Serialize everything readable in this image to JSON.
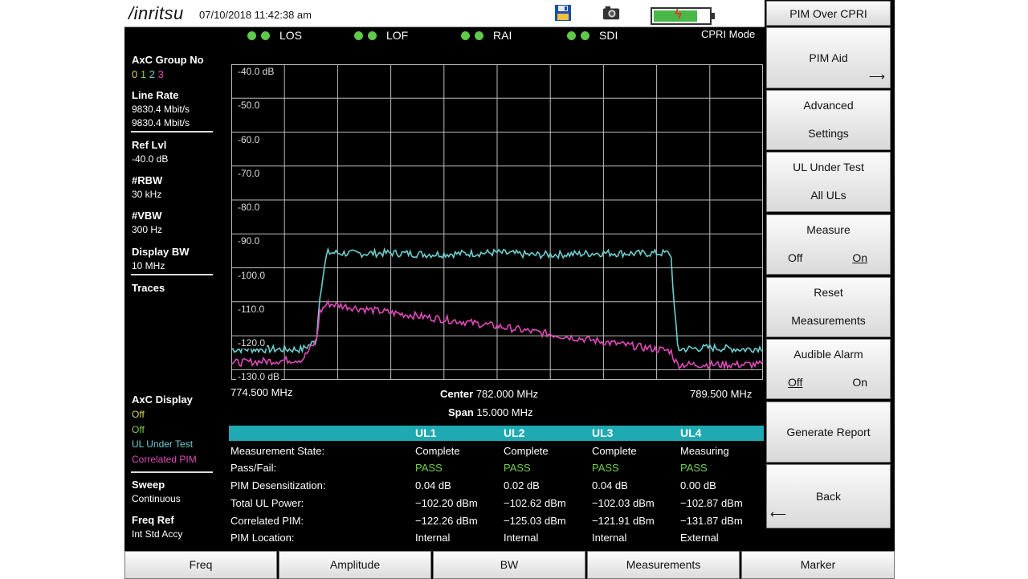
{
  "title_bar": {
    "brand": "/inritsu",
    "datetime": "07/10/2018 11:42:38 am",
    "icons": [
      "floppy-disk-icon",
      "camera-icon",
      "battery-charging-icon"
    ],
    "battery_level": 0.85
  },
  "alarms": [
    {
      "label": "LOS",
      "color": "#5fc94a"
    },
    {
      "label": "LOF",
      "color": "#5fc94a"
    },
    {
      "label": "RAI",
      "color": "#5fc94a"
    },
    {
      "label": "SDI",
      "color": "#5fc94a"
    }
  ],
  "mode": "CPRI Mode",
  "left_panel": {
    "axc_group": {
      "heading": "AxC Group No",
      "digits": [
        "0",
        "1",
        "2",
        "3"
      ],
      "digit_colors": [
        "#d8d860",
        "#7fd04a",
        "#6ccfd0",
        "#e04ab8"
      ]
    },
    "line_rate": {
      "heading": "Line Rate",
      "values": [
        "9830.4 Mbit/s",
        "9830.4 Mbit/s"
      ]
    },
    "ref_lvl": {
      "heading": "Ref Lvl",
      "value": "-40.0 dB"
    },
    "rbw": {
      "heading": "#RBW",
      "value": "30 kHz"
    },
    "vbw": {
      "heading": "#VBW",
      "value": "300 Hz"
    },
    "display_bw": {
      "heading": "Display BW",
      "value": "10 MHz"
    },
    "traces": {
      "heading": "Traces"
    },
    "axc_display": {
      "heading": "AxC Display",
      "items": [
        {
          "label": "Off",
          "color": "#d8d860"
        },
        {
          "label": "Off",
          "color": "#7fd04a"
        },
        {
          "label": "UL Under Test",
          "color": "#6ccfd0"
        },
        {
          "label": "Correlated PIM",
          "color": "#e04ab8"
        }
      ]
    },
    "sweep": {
      "heading": "Sweep",
      "value": "Continuous"
    },
    "freq_ref": {
      "heading": "Freq Ref",
      "value": "Int Std Accy"
    }
  },
  "chart_data": {
    "type": "line",
    "x_unit": "MHz",
    "y_unit": "dB",
    "xlim": [
      774.5,
      789.5
    ],
    "ylim": [
      -133.0,
      -40.0
    ],
    "y_tick_labels": [
      "-40.0 dB",
      "-50.0",
      "-60.0",
      "-70.0",
      "-80.0",
      "-90.0",
      "-100.0",
      "-110.0",
      "-120.0",
      "-130.0 dB"
    ],
    "y_ticks": [
      -40,
      -50,
      -60,
      -70,
      -80,
      -90,
      -100,
      -110,
      -120,
      -130
    ],
    "x_gridlines": 10,
    "grid": true,
    "start_label": "774.500 MHz",
    "end_label": "789.500 MHz",
    "center_label": "Center",
    "center_value": "782.000 MHz",
    "span_label": "Span",
    "span_value": "15.000 MHz",
    "series": [
      {
        "color": "#6ccfd0",
        "x": [
          774.5,
          775.5,
          776.5,
          776.9,
          777.0,
          777.2,
          778.0,
          779.0,
          780.0,
          781.0,
          782.0,
          783.0,
          784.0,
          785.0,
          786.0,
          786.9,
          787.0,
          787.1,
          788.0,
          789.0,
          789.5
        ],
        "y": [
          -124,
          -124,
          -124,
          -121.5,
          -108,
          -95.5,
          -95.8,
          -95.6,
          -96.0,
          -95.8,
          -95.5,
          -96.2,
          -96.0,
          -95.6,
          -95.8,
          -95.6,
          -112,
          -124,
          -123.5,
          -124,
          -123.5
        ]
      },
      {
        "color": "#e04ab8",
        "x": [
          774.5,
          775.5,
          776.5,
          776.9,
          777.0,
          777.2,
          778.0,
          779.0,
          780.0,
          781.0,
          782.0,
          783.0,
          784.0,
          785.0,
          786.0,
          786.9,
          787.0,
          787.1,
          788.0,
          789.0,
          789.5
        ],
        "y": [
          -128,
          -127.5,
          -127,
          -121.5,
          -113,
          -110.5,
          -111.8,
          -113.2,
          -114.5,
          -115.8,
          -117.2,
          -118.8,
          -120.3,
          -121.8,
          -123.3,
          -124.5,
          -127,
          -128.5,
          -128.5,
          -128.5,
          -128.5
        ]
      }
    ]
  },
  "measurements": {
    "columns": [
      "UL1",
      "UL2",
      "UL3",
      "UL4"
    ],
    "header_color": "#1fa9b2",
    "rows": [
      {
        "label": "Measurement State:",
        "values": [
          "Complete",
          "Complete",
          "Complete",
          "Measuring"
        ]
      },
      {
        "label": "Pass/Fail:",
        "values": [
          "PASS",
          "PASS",
          "PASS",
          "PASS"
        ]
      },
      {
        "label": "PIM Desensitization:",
        "values": [
          "0.04 dB",
          "0.02 dB",
          "0.04 dB",
          "0.00 dB"
        ]
      },
      {
        "label": "Total UL Power:",
        "values": [
          "−102.20 dBm",
          "−102.62 dBm",
          "−102.03 dBm",
          "−102.87 dBm"
        ]
      },
      {
        "label": "Correlated PIM:",
        "values": [
          "−122.26 dBm",
          "−125.03 dBm",
          "−121.91 dBm",
          "−131.87 dBm"
        ]
      },
      {
        "label": "PIM Location:",
        "values": [
          "Internal",
          "Internal",
          "Internal",
          "External"
        ]
      }
    ],
    "pass_color": "#6fd14a"
  },
  "softkeys": {
    "title": "PIM Over CPRI",
    "pim_aid": "PIM Aid",
    "advanced": {
      "line1": "Advanced",
      "line2": "Settings"
    },
    "ul_under_test": {
      "line1": "UL Under Test",
      "line2": "All ULs"
    },
    "measure": {
      "line1": "Measure",
      "off": "Off",
      "on": "On"
    },
    "reset": {
      "line1": "Reset",
      "line2": "Measurements"
    },
    "audible_alarm": {
      "line1": "Audible Alarm",
      "off": "Off",
      "on": "On"
    },
    "generate_report": "Generate Report",
    "back": "Back"
  },
  "bottom_keys": [
    "Freq",
    "Amplitude",
    "BW",
    "Measurements",
    "Marker"
  ]
}
